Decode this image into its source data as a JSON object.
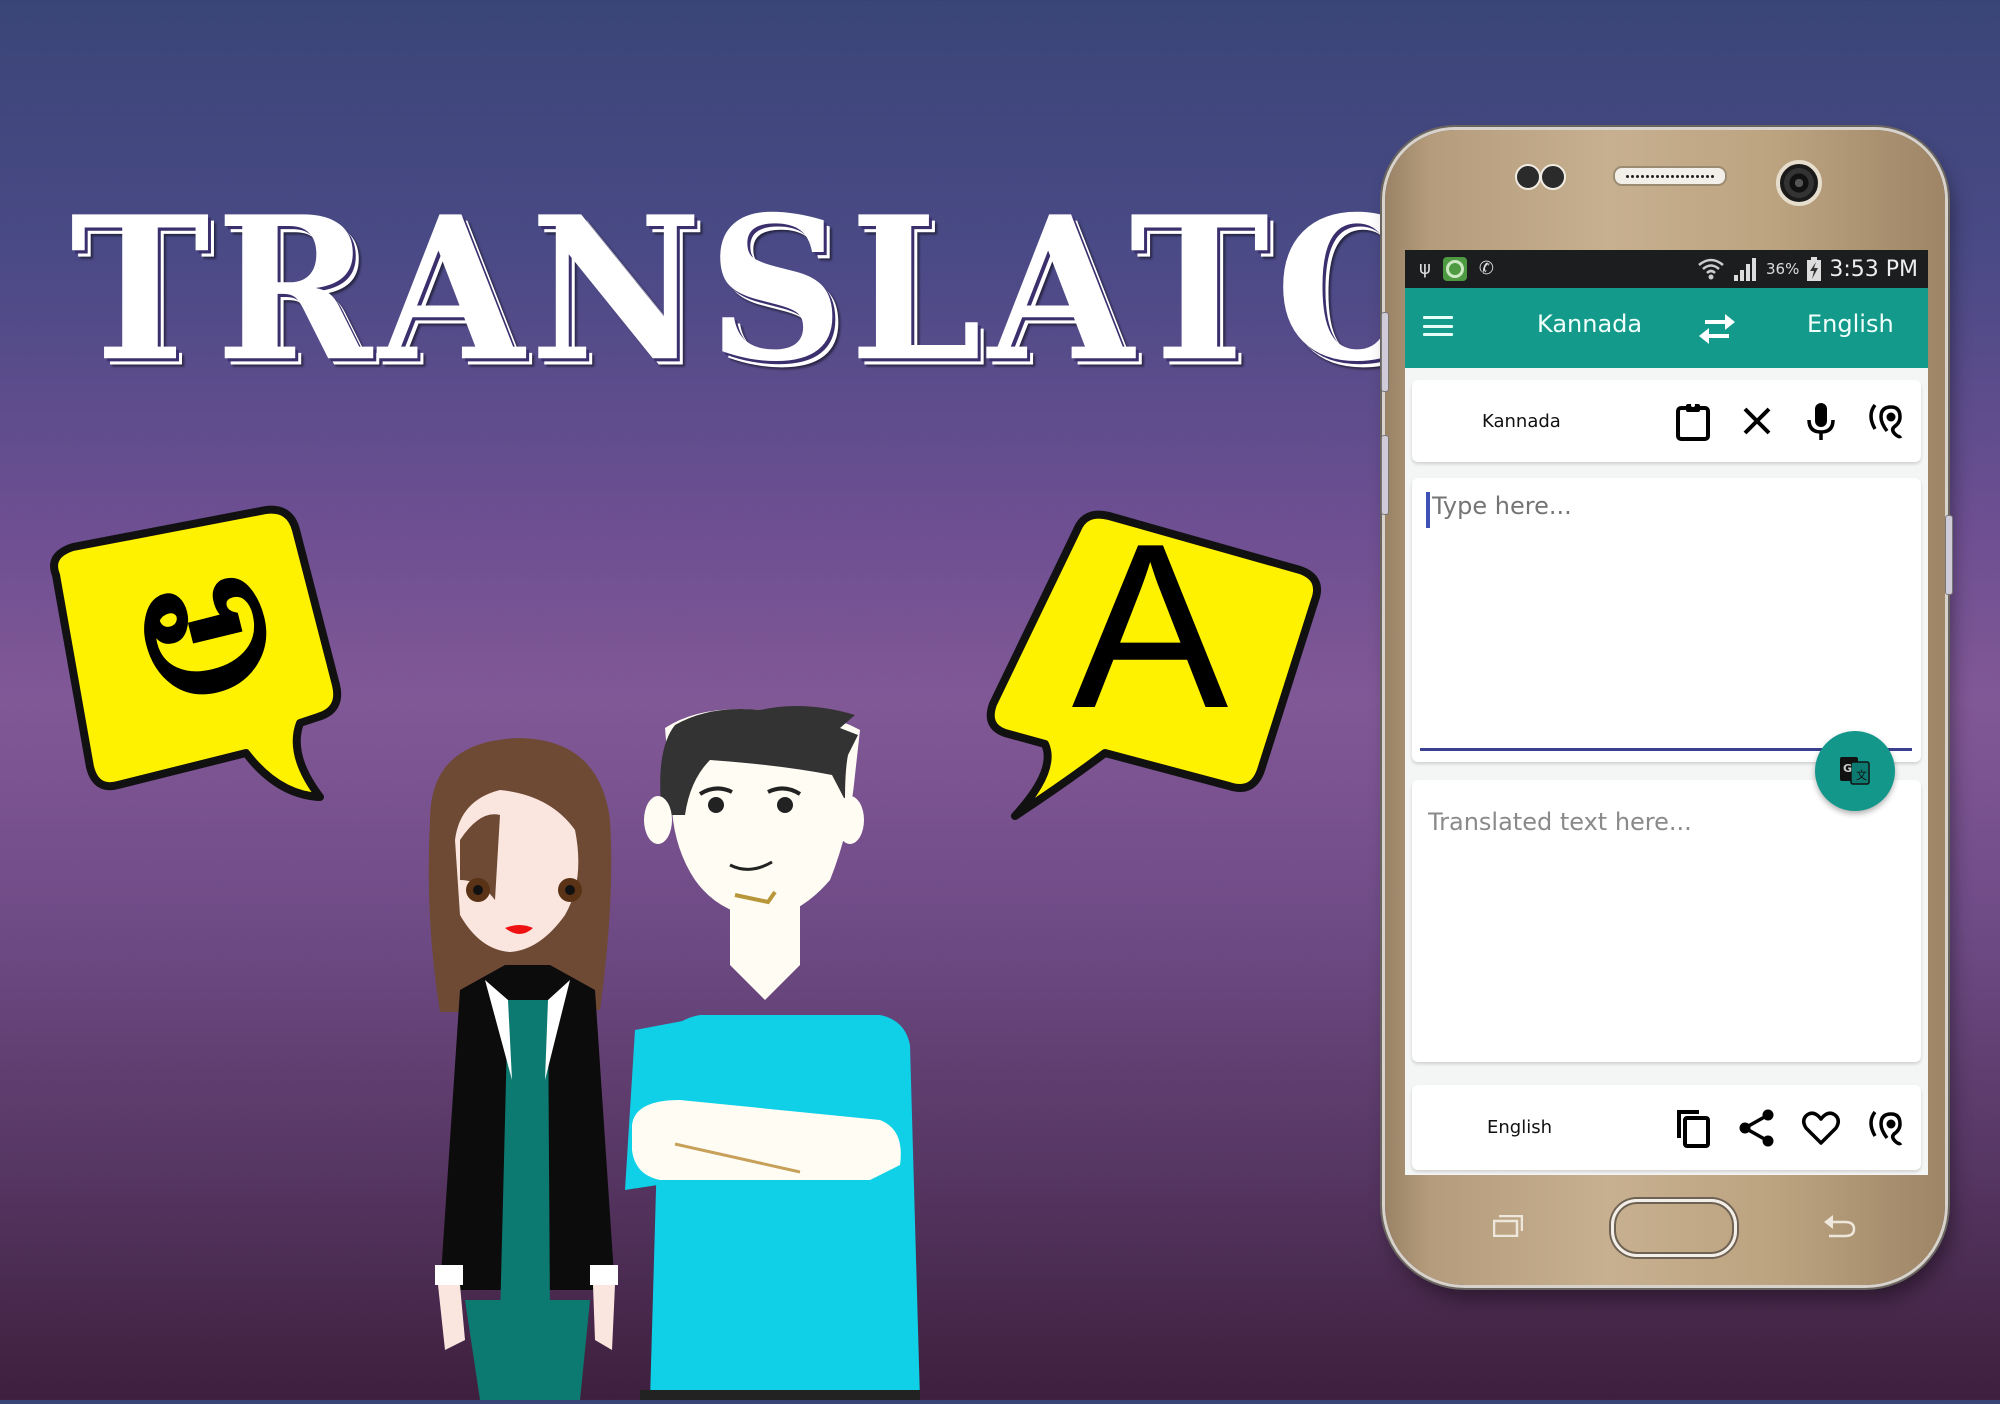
{
  "promo": {
    "title": "TRANSLATOR",
    "bubble_left_glyph": "ಅ",
    "bubble_right_glyph": "A",
    "colors": {
      "bubble_fill": "#fff200",
      "bubble_outline": "#111111",
      "bg_top": "#3a4577",
      "bg_mid": "#815896",
      "bg_bottom": "#3e1f3d"
    }
  },
  "status_bar": {
    "icons": [
      "usb-icon",
      "app-notification-icon",
      "missed-call-icon",
      "wifi-icon",
      "signal-icon",
      "battery-icon"
    ],
    "battery": "36%",
    "time": "3:53 PM"
  },
  "toolbar": {
    "source_language": "Kannada",
    "target_language": "English",
    "accent": "#139a8a"
  },
  "source_panel": {
    "language": "Kannada",
    "actions": [
      "paste",
      "clear",
      "voice-input",
      "listen"
    ]
  },
  "input": {
    "value": "",
    "placeholder": "Type here..."
  },
  "output": {
    "placeholder": "Translated text here..."
  },
  "target_panel": {
    "language": "English",
    "actions": [
      "copy",
      "share",
      "favorite",
      "listen"
    ]
  }
}
